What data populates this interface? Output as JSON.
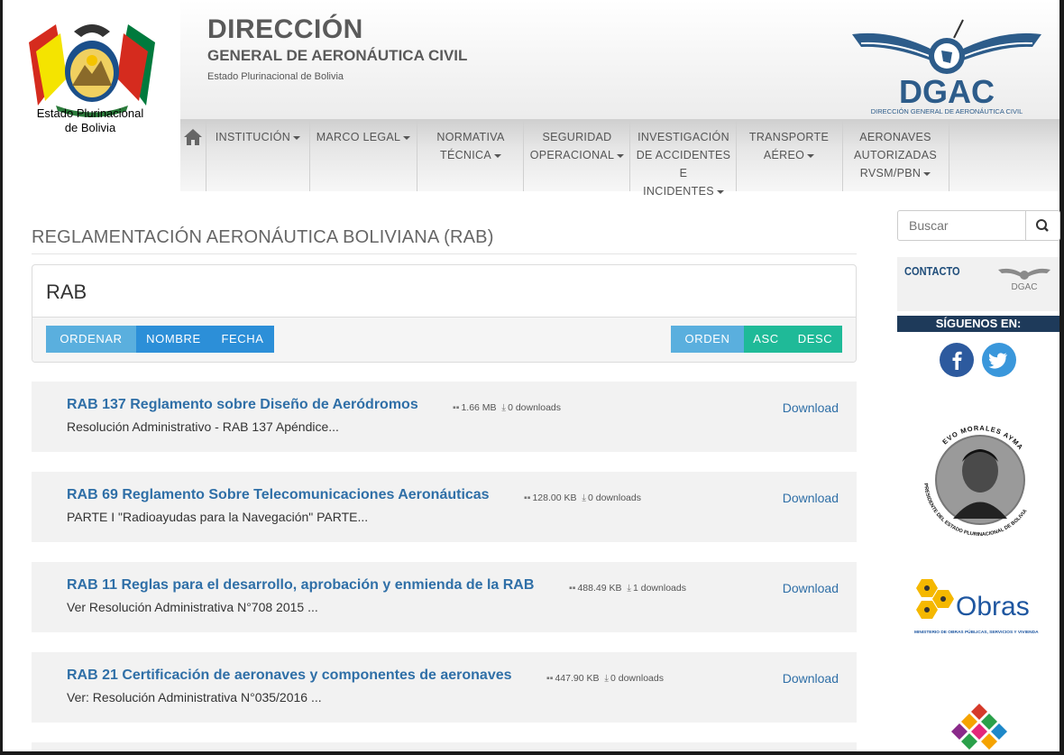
{
  "header": {
    "coat_caption_1": "Estado Plurinacional",
    "coat_caption_2": "de Bolivia",
    "title": "DIRECCIÓN",
    "subtitle": "GENERAL DE AERONÁUTICA CIVIL",
    "small": "Estado Plurinacional de Bolivia",
    "logo_text": "DGAC",
    "logo_sub": "DIRECCIÓN GENERAL DE AERONÁUTICA CIVIL"
  },
  "nav": {
    "items": [
      {
        "lines": [
          "INSTITUCIÓN"
        ]
      },
      {
        "lines": [
          "MARCO LEGAL"
        ]
      },
      {
        "lines": [
          "NORMATIVA",
          "TÉCNICA"
        ]
      },
      {
        "lines": [
          "SEGURIDAD",
          "OPERACIONAL"
        ]
      },
      {
        "lines": [
          "INVESTIGACIÓN",
          "DE ACCIDENTES E",
          "INCIDENTES"
        ]
      },
      {
        "lines": [
          "TRANSPORTE",
          "AÉREO"
        ]
      },
      {
        "lines": [
          "AERONAVES",
          "AUTORIZADAS",
          "RVSM/PBN"
        ]
      }
    ]
  },
  "main": {
    "page_title": "REGLAMENTACIÓN AERONÁUTICA BOLIVIANA (RAB)",
    "panel_title": "RAB",
    "sort": {
      "ordenar": "ORDENAR",
      "nombre": "NOMBRE",
      "fecha": "FECHA",
      "orden": "ORDEN",
      "asc": "ASC",
      "desc": "DESC"
    },
    "documents": [
      {
        "title": "RAB 137 Reglamento sobre Diseño de Aeródromos",
        "desc": "Resolución Administrativo - RAB 137 Apéndice...",
        "size": "1.66 MB",
        "downloads": "0 downloads",
        "link": "Download"
      },
      {
        "title": "RAB 69 Reglamento Sobre Telecomunicaciones Aeronáuticas",
        "desc": "PARTE I \"Radioayudas para la Navegación\" PARTE...",
        "size": "128.00 KB",
        "downloads": "0 downloads",
        "link": "Download"
      },
      {
        "title": "RAB 11 Reglas para el desarrollo, aprobación y enmienda de la RAB",
        "desc": "Ver Resolución Administrativa N°708 2015 ...",
        "size": "488.49 KB",
        "downloads": "1 downloads",
        "link": "Download"
      },
      {
        "title": "RAB 21 Certificación de aeronaves y componentes de aeronaves",
        "desc": "Ver: Resolución Administrativa N°035/2016 ...",
        "size": "447.90 KB",
        "downloads": "0 downloads",
        "link": "Download"
      }
    ]
  },
  "sidebar": {
    "search_placeholder": "Buscar",
    "contact": "CONTACTO",
    "contact_logo": "DGAC",
    "follow": "SÍGUENOS EN:",
    "facebook": "f",
    "evo_text_top": "EVO MORALES AYMA",
    "evo_text_bottom": "PRESIDENTE DEL ESTADO PLURINACIONAL DE BOLIVIA",
    "obras": "Obras",
    "obras_sub": "MINISTERIO DE OBRAS PÚBLICAS, SERVICIOS Y VIVIENDA"
  },
  "colors": {
    "link_blue": "#2f6fa7",
    "btn_light_blue": "#5aafde",
    "btn_blue": "#2c8fd8",
    "btn_teal": "#1fba98",
    "navy": "#1e3a5a"
  }
}
